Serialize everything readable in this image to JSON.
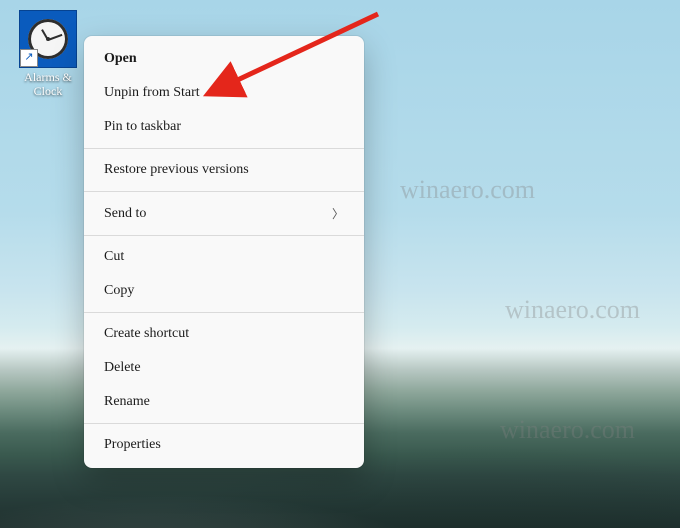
{
  "desktop_icon": {
    "label": "Alarms & Clock",
    "icon_name": "clock-icon",
    "has_shortcut_overlay": true
  },
  "context_menu": {
    "open": "Open",
    "unpin_from_start": "Unpin from Start",
    "pin_to_taskbar": "Pin to taskbar",
    "restore_previous_versions": "Restore previous versions",
    "send_to": "Send to",
    "cut": "Cut",
    "copy": "Copy",
    "create_shortcut": "Create shortcut",
    "delete": "Delete",
    "rename": "Rename",
    "properties": "Properties"
  },
  "annotation": {
    "arrow_color": "#e4261b",
    "target": "unpin_from_start"
  },
  "watermark_text": "winaero.com"
}
